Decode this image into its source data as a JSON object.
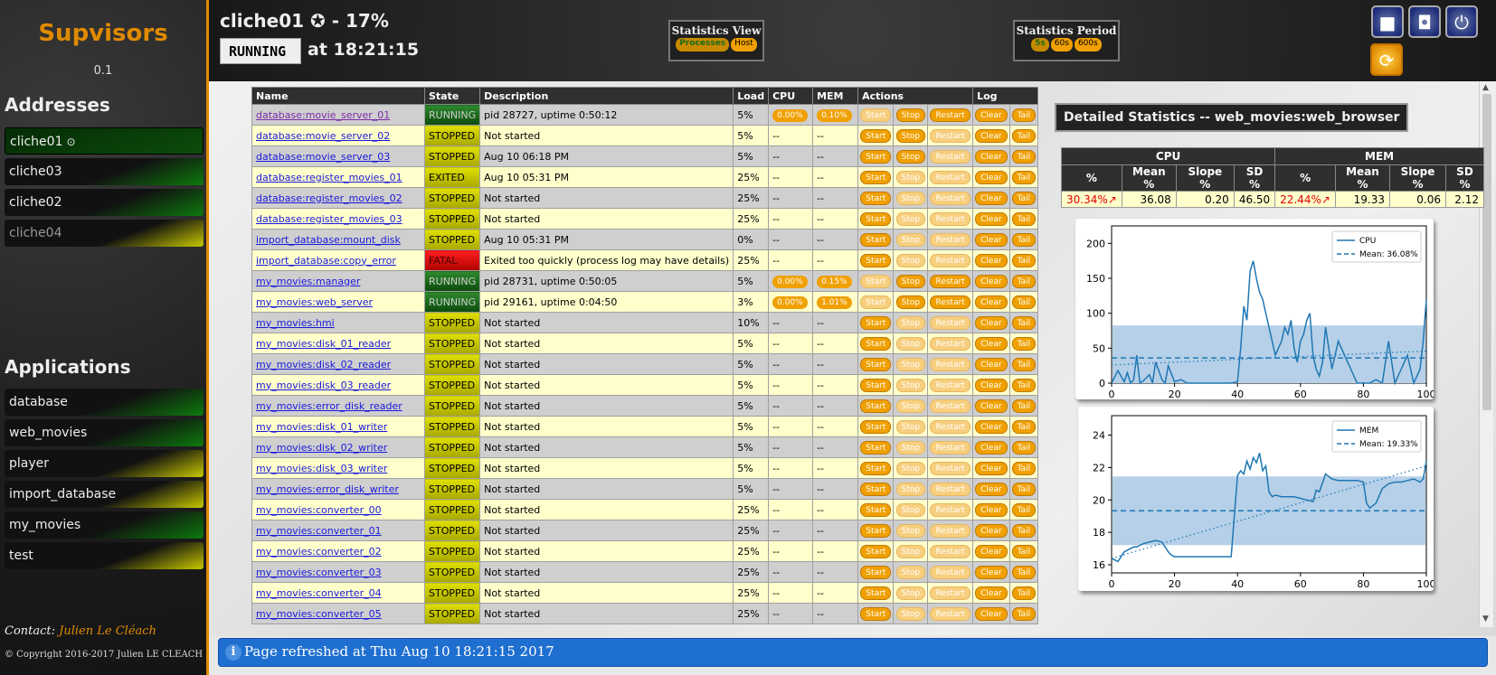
{
  "app": {
    "title": "Supvisors",
    "version": "0.1"
  },
  "sidebar": {
    "addresses_title": "Addresses",
    "addresses": [
      {
        "label": "cliche01",
        "marker": "⊙",
        "style": "selected"
      },
      {
        "label": "cliche03",
        "style": "green"
      },
      {
        "label": "cliche02",
        "style": "green"
      },
      {
        "label": "cliche04",
        "style": "yellow disabled"
      }
    ],
    "applications_title": "Applications",
    "applications": [
      {
        "label": "database",
        "style": "green"
      },
      {
        "label": "web_movies",
        "style": "green"
      },
      {
        "label": "player",
        "style": "yellow"
      },
      {
        "label": "import_database",
        "style": "yellow"
      },
      {
        "label": "my_movies",
        "style": "green"
      },
      {
        "label": "test",
        "style": "yellow"
      }
    ],
    "contact_label": "Contact:",
    "contact_name": "Julien Le Cléach",
    "copyright": "© Copyright 2016-2017 Julien LE CLEACH"
  },
  "header": {
    "node_title": "cliche01 ✪ - 17%",
    "state": "RUNNING",
    "state_time": "at 18:21:15",
    "stats_view": {
      "title": "Statistics View",
      "options": [
        "Processes",
        "Host"
      ],
      "selected": "Processes"
    },
    "stats_period": {
      "title": "Statistics Period",
      "options": [
        "5s",
        "60s",
        "600s"
      ],
      "selected": "5s"
    }
  },
  "table": {
    "headers": [
      "Name",
      "State",
      "Description",
      "Load",
      "CPU",
      "MEM",
      "Actions",
      "Log"
    ],
    "action_labels": [
      "Start",
      "Stop",
      "Restart"
    ],
    "log_labels": [
      "Clear",
      "Tail"
    ],
    "rows": [
      {
        "name": "database:movie_server_01",
        "visited": true,
        "state": "RUNNING",
        "desc": "pid 28727, uptime 0:50:12",
        "load": "5%",
        "cpu": "0.00%",
        "mem": "0.10%",
        "start": false,
        "stop": true,
        "restart": true
      },
      {
        "name": "database:movie_server_02",
        "state": "STOPPED",
        "desc": "Not started",
        "load": "5%",
        "cpu": "--",
        "mem": "--",
        "start": true,
        "stop": true,
        "restart": false
      },
      {
        "name": "database:movie_server_03",
        "state": "STOPPED",
        "desc": "Aug 10 06:18 PM",
        "load": "5%",
        "cpu": "--",
        "mem": "--",
        "start": true,
        "stop": true,
        "restart": false
      },
      {
        "name": "database:register_movies_01",
        "state": "EXITED",
        "desc": "Aug 10 05:31 PM",
        "load": "25%",
        "cpu": "--",
        "mem": "--",
        "start": true,
        "stop": false,
        "restart": false
      },
      {
        "name": "database:register_movies_02",
        "state": "STOPPED",
        "desc": "Not started",
        "load": "25%",
        "cpu": "--",
        "mem": "--",
        "start": true,
        "stop": false,
        "restart": false
      },
      {
        "name": "database:register_movies_03",
        "state": "STOPPED",
        "desc": "Not started",
        "load": "25%",
        "cpu": "--",
        "mem": "--",
        "start": true,
        "stop": false,
        "restart": false
      },
      {
        "name": "import_database:mount_disk",
        "state": "STOPPED",
        "desc": "Aug 10 05:31 PM",
        "load": "0%",
        "cpu": "--",
        "mem": "--",
        "start": true,
        "stop": false,
        "restart": false
      },
      {
        "name": "import_database:copy_error",
        "state": "FATAL",
        "desc": "Exited too quickly (process log may have details)",
        "load": "25%",
        "cpu": "--",
        "mem": "--",
        "start": true,
        "stop": false,
        "restart": false
      },
      {
        "name": "my_movies:manager",
        "state": "RUNNING",
        "desc": "pid 28731, uptime 0:50:05",
        "load": "5%",
        "cpu": "0.00%",
        "mem": "0.15%",
        "start": false,
        "stop": true,
        "restart": true
      },
      {
        "name": "my_movies:web_server",
        "state": "RUNNING",
        "desc": "pid 29161, uptime 0:04:50",
        "load": "3%",
        "cpu": "0.00%",
        "mem": "1.01%",
        "start": false,
        "stop": true,
        "restart": true
      },
      {
        "name": "my_movies:hmi",
        "state": "STOPPED",
        "desc": "Not started",
        "load": "10%",
        "cpu": "--",
        "mem": "--",
        "start": true,
        "stop": false,
        "restart": false
      },
      {
        "name": "my_movies:disk_01_reader",
        "state": "STOPPED",
        "desc": "Not started",
        "load": "5%",
        "cpu": "--",
        "mem": "--",
        "start": true,
        "stop": false,
        "restart": false
      },
      {
        "name": "my_movies:disk_02_reader",
        "state": "STOPPED",
        "desc": "Not started",
        "load": "5%",
        "cpu": "--",
        "mem": "--",
        "start": true,
        "stop": false,
        "restart": false
      },
      {
        "name": "my_movies:disk_03_reader",
        "state": "STOPPED",
        "desc": "Not started",
        "load": "5%",
        "cpu": "--",
        "mem": "--",
        "start": true,
        "stop": false,
        "restart": false
      },
      {
        "name": "my_movies:error_disk_reader",
        "state": "STOPPED",
        "desc": "Not started",
        "load": "5%",
        "cpu": "--",
        "mem": "--",
        "start": true,
        "stop": false,
        "restart": false
      },
      {
        "name": "my_movies:disk_01_writer",
        "state": "STOPPED",
        "desc": "Not started",
        "load": "5%",
        "cpu": "--",
        "mem": "--",
        "start": true,
        "stop": false,
        "restart": false
      },
      {
        "name": "my_movies:disk_02_writer",
        "state": "STOPPED",
        "desc": "Not started",
        "load": "5%",
        "cpu": "--",
        "mem": "--",
        "start": true,
        "stop": false,
        "restart": false
      },
      {
        "name": "my_movies:disk_03_writer",
        "state": "STOPPED",
        "desc": "Not started",
        "load": "5%",
        "cpu": "--",
        "mem": "--",
        "start": true,
        "stop": false,
        "restart": false
      },
      {
        "name": "my_movies:error_disk_writer",
        "state": "STOPPED",
        "desc": "Not started",
        "load": "5%",
        "cpu": "--",
        "mem": "--",
        "start": true,
        "stop": false,
        "restart": false
      },
      {
        "name": "my_movies:converter_00",
        "state": "STOPPED",
        "desc": "Not started",
        "load": "25%",
        "cpu": "--",
        "mem": "--",
        "start": true,
        "stop": false,
        "restart": false
      },
      {
        "name": "my_movies:converter_01",
        "state": "STOPPED",
        "desc": "Not started",
        "load": "25%",
        "cpu": "--",
        "mem": "--",
        "start": true,
        "stop": false,
        "restart": false
      },
      {
        "name": "my_movies:converter_02",
        "state": "STOPPED",
        "desc": "Not started",
        "load": "25%",
        "cpu": "--",
        "mem": "--",
        "start": true,
        "stop": false,
        "restart": false
      },
      {
        "name": "my_movies:converter_03",
        "state": "STOPPED",
        "desc": "Not started",
        "load": "25%",
        "cpu": "--",
        "mem": "--",
        "start": true,
        "stop": false,
        "restart": false
      },
      {
        "name": "my_movies:converter_04",
        "state": "STOPPED",
        "desc": "Not started",
        "load": "25%",
        "cpu": "--",
        "mem": "--",
        "start": true,
        "stop": false,
        "restart": false
      },
      {
        "name": "my_movies:converter_05",
        "state": "STOPPED",
        "desc": "Not started",
        "load": "25%",
        "cpu": "--",
        "mem": "--",
        "start": true,
        "stop": false,
        "restart": false
      }
    ]
  },
  "detail": {
    "title": "Detailed Statistics -- web_movies:web_browser",
    "groups": [
      "CPU",
      "MEM"
    ],
    "columns": [
      "%",
      "Mean %",
      "Slope %",
      "SD %",
      "%",
      "Mean %",
      "Slope %",
      "SD %"
    ],
    "values": [
      "30.34%↗",
      "36.08",
      "0.20",
      "46.50",
      "22.44%↗",
      "19.33",
      "0.06",
      "2.12"
    ]
  },
  "chart_data": [
    {
      "type": "line",
      "series": [
        {
          "name": "CPU",
          "x": [
            0,
            2,
            4,
            5,
            6,
            7,
            8,
            9,
            10,
            12,
            13,
            14,
            16,
            17,
            18,
            20,
            22,
            24,
            26,
            28,
            30,
            32,
            34,
            36,
            38,
            40,
            41,
            42,
            43,
            44,
            45,
            46,
            47,
            48,
            49,
            50,
            51,
            52,
            54,
            55,
            56,
            57,
            58,
            59,
            60,
            61,
            62,
            63,
            64,
            65,
            66,
            67,
            68,
            70,
            72,
            74,
            76,
            78,
            80,
            82,
            84,
            86,
            88,
            90,
            92,
            94,
            96,
            98,
            99,
            100
          ],
          "y": [
            0,
            18,
            2,
            15,
            0,
            5,
            40,
            0,
            3,
            12,
            0,
            30,
            5,
            0,
            25,
            2,
            5,
            0,
            0,
            0,
            0,
            0,
            0,
            0,
            0,
            2,
            50,
            110,
            90,
            160,
            175,
            150,
            130,
            120,
            100,
            80,
            60,
            40,
            60,
            80,
            70,
            90,
            50,
            30,
            60,
            70,
            90,
            100,
            40,
            20,
            10,
            30,
            80,
            20,
            60,
            40,
            20,
            0,
            0,
            0,
            5,
            0,
            60,
            0,
            20,
            40,
            0,
            20,
            60,
            120
          ]
        },
        {
          "name": "Mean: 36.08%",
          "x": [
            0,
            100
          ],
          "y": [
            36.08,
            36.08
          ]
        }
      ],
      "ylim": [
        0,
        225
      ],
      "xlim": [
        0,
        100
      ],
      "xticks": [
        0,
        20,
        40,
        60,
        80,
        100
      ],
      "yticks": [
        0,
        50,
        100,
        150,
        200
      ],
      "band": [
        0,
        82.58
      ],
      "trend": [
        [
          0,
          26
        ],
        [
          100,
          46
        ]
      ],
      "legend": "top-right"
    },
    {
      "type": "line",
      "series": [
        {
          "name": "MEM",
          "x": [
            0,
            1,
            2,
            3,
            4,
            5,
            6,
            7,
            8,
            9,
            10,
            12,
            14,
            16,
            18,
            19,
            20,
            22,
            24,
            26,
            28,
            30,
            32,
            34,
            36,
            38,
            39,
            40,
            41,
            42,
            43,
            44,
            45,
            46,
            47,
            48,
            49,
            50,
            51,
            52,
            54,
            56,
            58,
            60,
            62,
            64,
            65,
            66,
            68,
            70,
            72,
            74,
            76,
            78,
            80,
            81,
            82,
            84,
            86,
            88,
            90,
            92,
            94,
            96,
            98,
            99,
            100
          ],
          "y": [
            16.4,
            16.3,
            16.2,
            16.5,
            16.8,
            16.9,
            17.0,
            17.1,
            17.1,
            17.2,
            17.3,
            17.4,
            17.5,
            17.4,
            16.8,
            16.6,
            16.5,
            16.5,
            16.5,
            16.5,
            16.5,
            16.5,
            16.5,
            16.5,
            16.5,
            16.5,
            19.0,
            21.5,
            21.8,
            21.6,
            22.4,
            21.9,
            22.6,
            22.3,
            22.9,
            21.8,
            22.1,
            20.5,
            20.2,
            20.3,
            20.2,
            20.2,
            20.2,
            20.1,
            20.0,
            19.9,
            20.6,
            20.5,
            21.6,
            21.3,
            21.2,
            21.2,
            21.2,
            21.2,
            21.1,
            19.8,
            19.5,
            19.8,
            20.7,
            21.0,
            21.1,
            21.1,
            21.2,
            21.3,
            21.1,
            21.3,
            22.4
          ]
        },
        {
          "name": "Mean: 19.33%",
          "x": [
            0,
            100
          ],
          "y": [
            19.33,
            19.33
          ]
        }
      ],
      "ylim": [
        15.5,
        25.2
      ],
      "xlim": [
        0,
        100
      ],
      "xticks": [
        0,
        20,
        40,
        60,
        80,
        100
      ],
      "yticks": [
        16,
        18,
        20,
        22,
        24
      ],
      "band": [
        17.21,
        21.45
      ],
      "trend": [
        [
          0,
          16.4
        ],
        [
          100,
          22.1
        ]
      ],
      "legend": "top-right"
    }
  ],
  "footer": {
    "message": "Page refreshed at Thu Aug 10 18:21:15 2017",
    "icon": "info-icon"
  },
  "colors": {
    "accent": "#e08a00",
    "running": "#1f7a1f",
    "stopped": "#d4d400",
    "fatal": "#ee0000",
    "button": "#f0a000",
    "line": "#1f77b4"
  }
}
